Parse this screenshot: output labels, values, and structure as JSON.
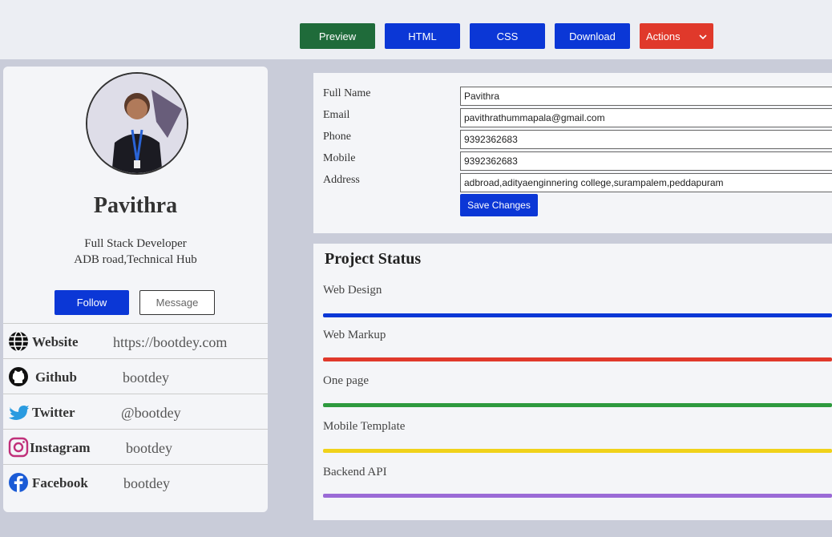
{
  "toolbar": {
    "preview_label": "Preview",
    "html_label": "HTML",
    "css_label": "CSS",
    "download_label": "Download",
    "actions_label": "Actions"
  },
  "profile": {
    "name": "Pavithra",
    "role": "Full Stack Developer",
    "location": "ADB road,Technical Hub",
    "follow_label": "Follow",
    "message_label": "Message",
    "social": [
      {
        "icon": "globe-icon",
        "label": "Website",
        "value": "https://bootdey.com"
      },
      {
        "icon": "github-icon",
        "label": "Github",
        "value": "bootdey"
      },
      {
        "icon": "twitter-icon",
        "label": "Twitter",
        "value": "@bootdey"
      },
      {
        "icon": "instagram-icon",
        "label": "Instagram",
        "value": "bootdey"
      },
      {
        "icon": "facebook-icon",
        "label": "Facebook",
        "value": "bootdey"
      }
    ]
  },
  "form": {
    "full_name_label": "Full Name",
    "full_name_value": "Pavithra",
    "email_label": "Email",
    "email_value": "pavithrathummapala@gmail.com",
    "phone_label": "Phone",
    "phone_value": "9392362683",
    "mobile_label": "Mobile",
    "mobile_value": "9392362683",
    "address_label": "Address",
    "address_value": "adbroad,adityaenginnering college,surampalem,peddapuram",
    "save_label": "Save Changes"
  },
  "project_status": {
    "title": "Project Status",
    "items": [
      {
        "label": "Web Design",
        "color": "#0b37d6"
      },
      {
        "label": "Web Markup",
        "color": "#e0392b"
      },
      {
        "label": "One page",
        "color": "#2e9a3e"
      },
      {
        "label": "Mobile Template",
        "color": "#f0d21a"
      },
      {
        "label": "Backend API",
        "color": "#9a6ad6"
      }
    ]
  }
}
